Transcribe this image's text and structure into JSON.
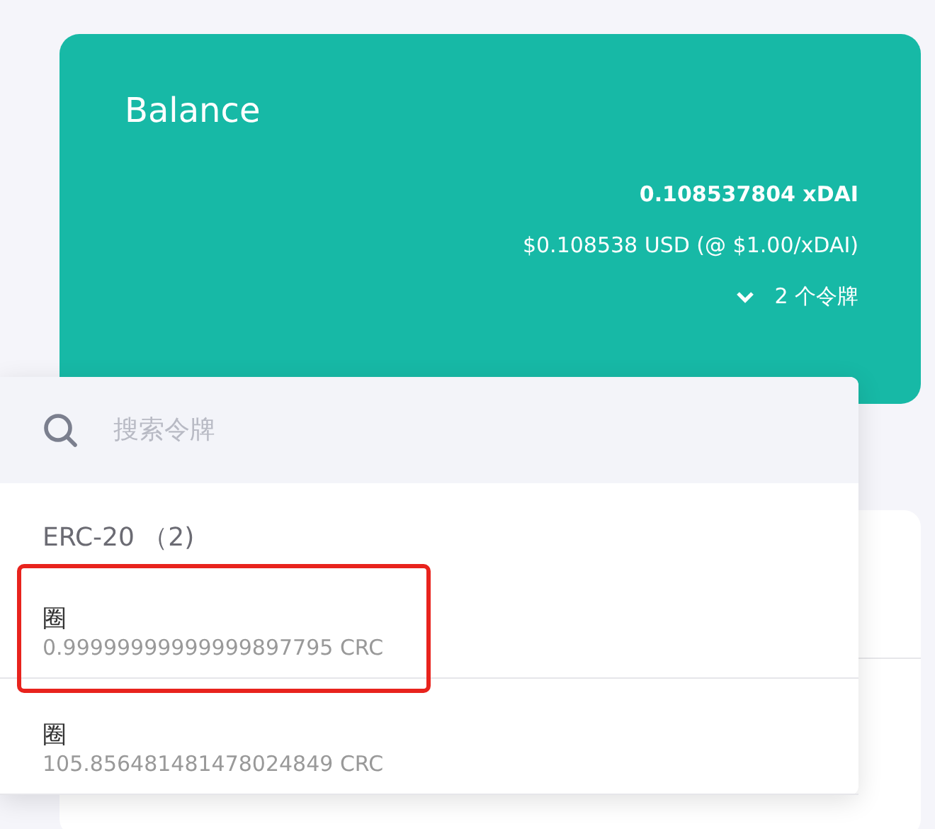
{
  "balance": {
    "title": "Balance",
    "amount": "0.108537804 xDAI",
    "fiat": "$0.108538 USD (@ $1.00/xDAI)",
    "tokens_toggle": {
      "label": "2 个令牌",
      "expanded": true
    }
  },
  "token_dropdown": {
    "search": {
      "placeholder": "搜索令牌"
    },
    "groups": [
      {
        "title": "ERC-20 （2)",
        "tokens": [
          {
            "name": "圈",
            "amount": "0.99999999999999897795 CRC",
            "highlighted": true
          },
          {
            "name": "圈",
            "amount": "105.856481481478024849 CRC",
            "highlighted": false
          }
        ]
      }
    ]
  }
}
